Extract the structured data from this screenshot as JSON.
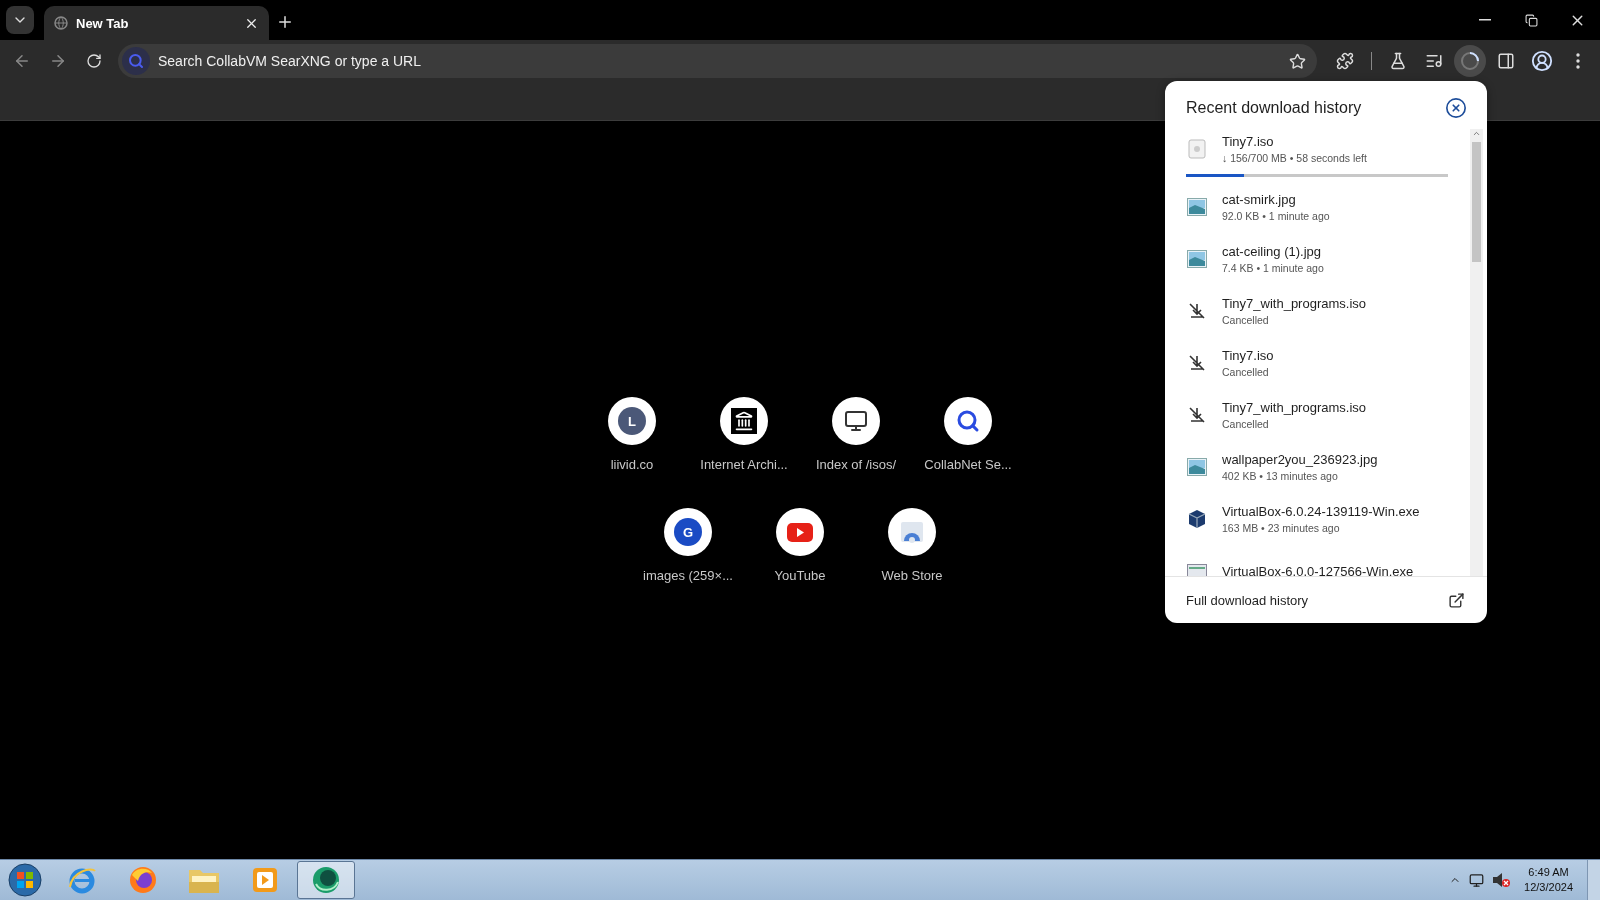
{
  "tabs": [
    {
      "title": "New Tab",
      "selected": true
    }
  ],
  "omnibox": {
    "placeholder": "Search CollabVM SearXNG or type a URL"
  },
  "shortcuts": [
    {
      "label": "liivid.co",
      "kind": "letter",
      "letter": "L",
      "color": "#4b5878"
    },
    {
      "label": "Internet Archi...",
      "kind": "archive"
    },
    {
      "label": "Index of /isos/",
      "kind": "computer"
    },
    {
      "label": "CollabNet Se...",
      "kind": "search"
    },
    {
      "label": "images (259×...",
      "kind": "letter",
      "letter": "G",
      "color": "#1a4bc4"
    },
    {
      "label": "YouTube",
      "kind": "video"
    },
    {
      "label": "Web Store",
      "kind": "store"
    }
  ],
  "downloads": {
    "title": "Recent download history",
    "items": [
      {
        "kind": "progress",
        "name": "Tiny7.iso",
        "meta": "↓ 156/700 MB • 58 seconds left",
        "level": 0.22
      },
      {
        "kind": "image",
        "name": "cat-smirk.jpg",
        "meta": "92.0 KB • 1 minute ago"
      },
      {
        "kind": "image",
        "name": "cat-ceiling (1).jpg",
        "meta": "7.4 KB • 1 minute ago"
      },
      {
        "kind": "cancelled",
        "name": "Tiny7_with_programs.iso",
        "meta": "Cancelled"
      },
      {
        "kind": "cancelled",
        "name": "Tiny7.iso",
        "meta": "Cancelled"
      },
      {
        "kind": "cancelled",
        "name": "Tiny7_with_programs.iso",
        "meta": "Cancelled"
      },
      {
        "kind": "image",
        "name": "wallpaper2you_236923.jpg",
        "meta": "402 KB • 13 minutes ago"
      },
      {
        "kind": "app",
        "name": "VirtualBox-6.0.24-139119-Win.exe",
        "meta": "163 MB • 23 minutes ago"
      },
      {
        "kind": "program",
        "name": "VirtualBox-6.0.0-127566-Win.exe"
      }
    ],
    "footer": "Full download history"
  },
  "taskbar": {
    "apps": [
      {
        "kind": "browser-e",
        "selected": false
      },
      {
        "kind": "fox",
        "selected": false
      },
      {
        "kind": "folder",
        "selected": false
      },
      {
        "kind": "player",
        "selected": false
      },
      {
        "kind": "globe",
        "selected": true
      }
    ],
    "time": "6:49 AM",
    "date": "12/3/2024"
  }
}
